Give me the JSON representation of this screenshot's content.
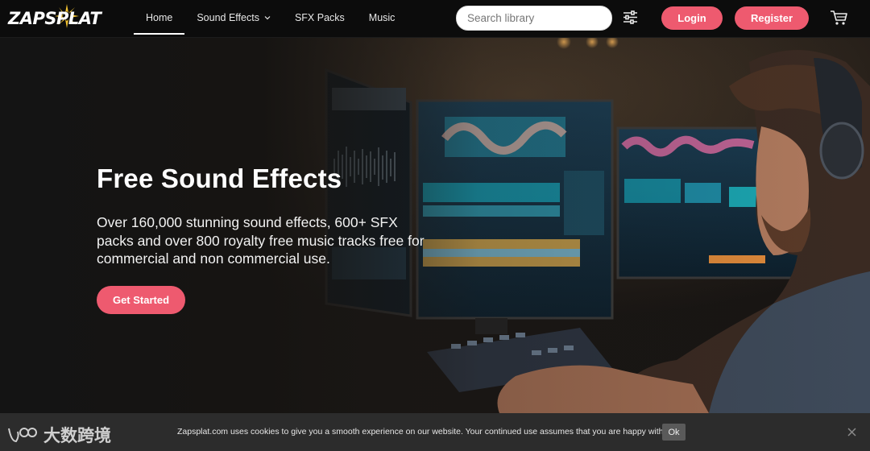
{
  "brand": {
    "name": "ZAPSPLAT"
  },
  "nav": {
    "items": [
      {
        "label": "Home",
        "active": true
      },
      {
        "label": "Sound Effects",
        "has_dropdown": true
      },
      {
        "label": "SFX Packs"
      },
      {
        "label": "Music"
      }
    ],
    "search": {
      "placeholder": "Search library",
      "value": ""
    },
    "login_label": "Login",
    "register_label": "Register",
    "icons": [
      "search-icon",
      "filter-sliders-icon",
      "cart-icon",
      "chevron-down-icon"
    ]
  },
  "hero": {
    "title": "Free Sound Effects",
    "description": "Over 160,000 stunning sound effects, 600+ SFX packs and over 800 royalty free music tracks free for commercial and non commercial use.",
    "cta_label": "Get Started"
  },
  "cookie_bar": {
    "text": "Zapsplat.com uses cookies to give you a smooth experience on our website. Your continued use assumes that you are happy with that.",
    "ok_label": "Ok"
  },
  "watermark": {
    "text": "大数跨境"
  },
  "colors": {
    "accent": "#ee5a6f",
    "nav_bg": "#0c0c0c",
    "cookie_bg": "#2c2c2c",
    "logo_burst": "#f2c230"
  }
}
